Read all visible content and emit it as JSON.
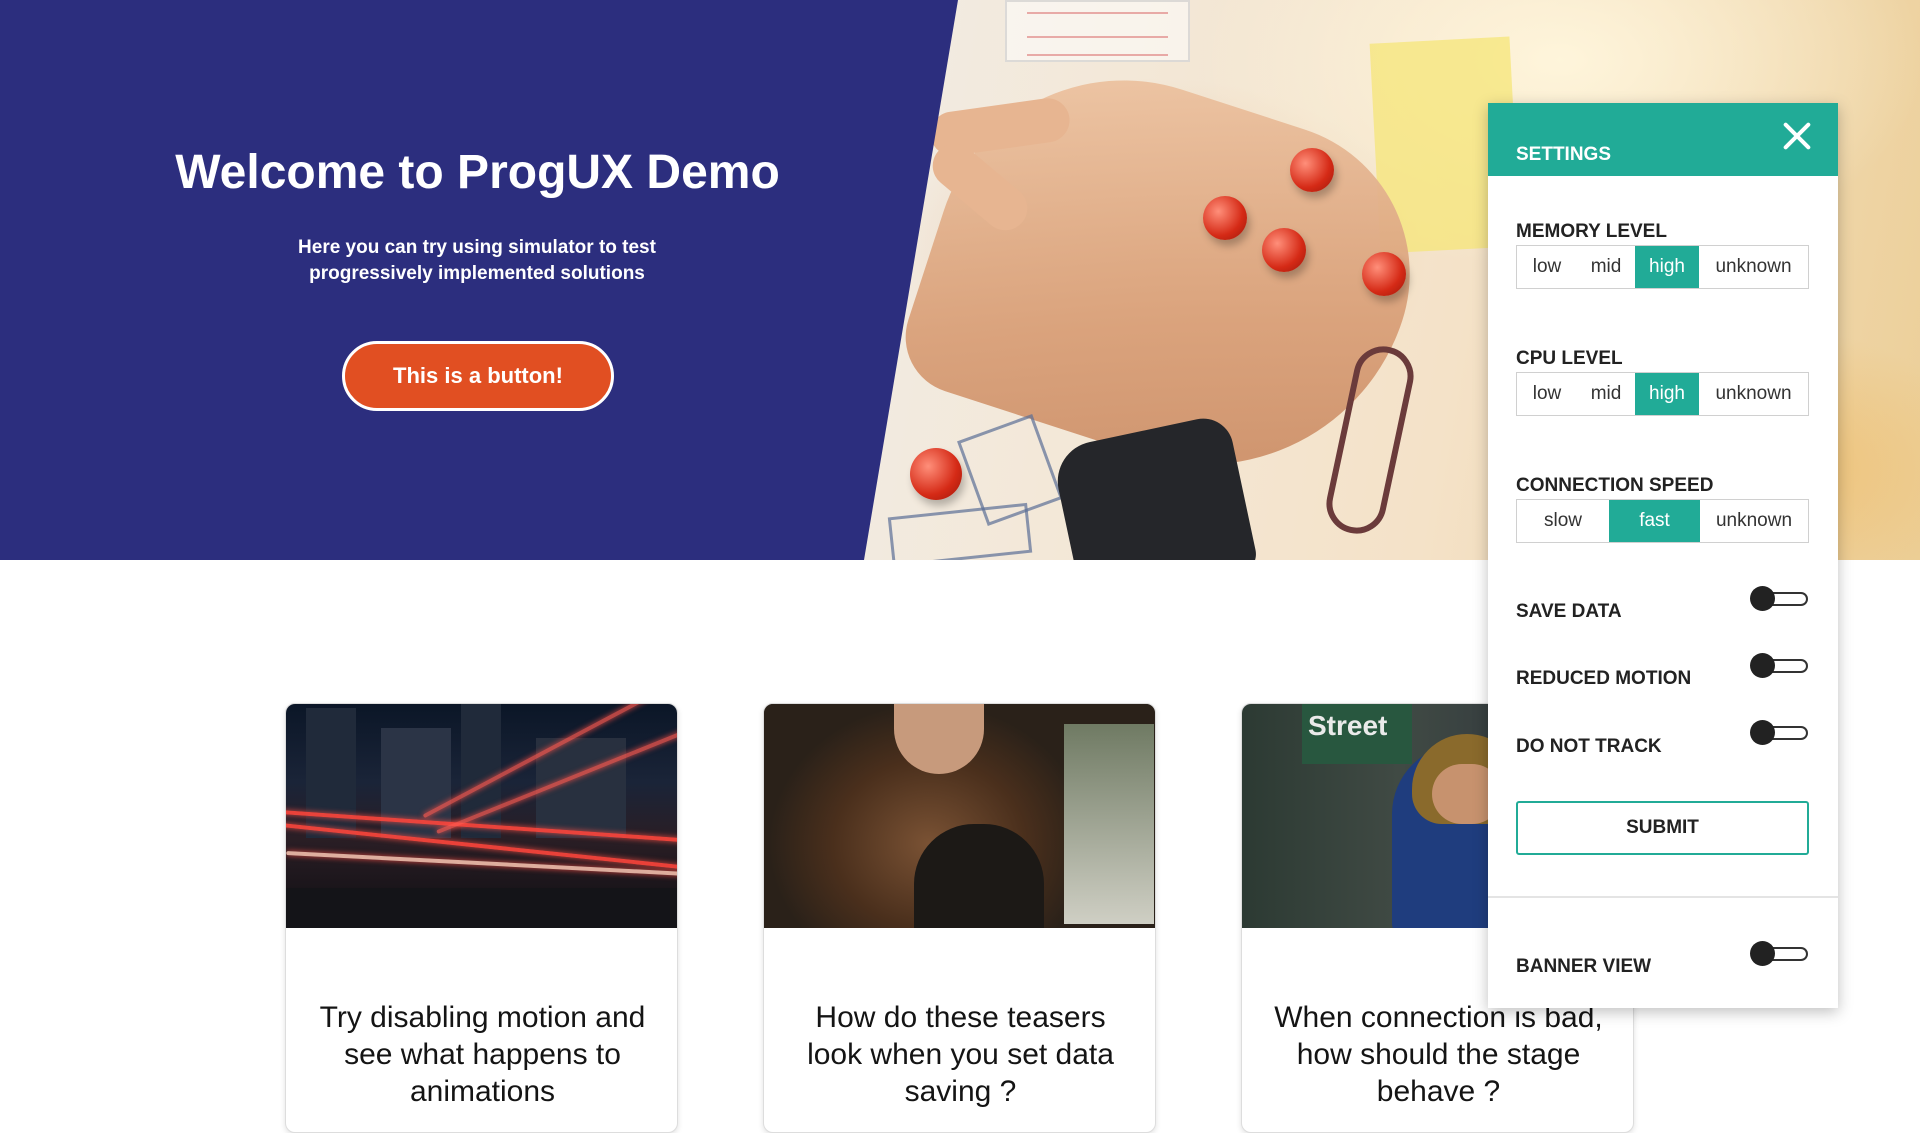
{
  "hero": {
    "title": "Welcome to ProgUX Demo",
    "subtitle": "Here you can try using simulator to test progressively implemented solutions",
    "button_label": "This is a button!"
  },
  "cards": [
    {
      "title": "Try disabling motion and see what happens to animations",
      "image": "city-light-trails-photo"
    },
    {
      "title": "How do these teasers look when you set data saving ?",
      "image": "curly-hair-woman-photo"
    },
    {
      "title": "When connection is bad, how should the stage behave ?",
      "image": "street-hooded-man-photo"
    }
  ],
  "settings": {
    "title": "SETTINGS",
    "close_icon": "close-icon",
    "memory": {
      "label": "MEMORY LEVEL",
      "options": [
        "low",
        "mid",
        "high",
        "unknown"
      ],
      "selected": "high"
    },
    "cpu": {
      "label": "CPU LEVEL",
      "options": [
        "low",
        "mid",
        "high",
        "unknown"
      ],
      "selected": "high"
    },
    "connection": {
      "label": "CONNECTION SPEED",
      "options": [
        "slow",
        "fast",
        "unknown"
      ],
      "selected": "fast"
    },
    "save_data": {
      "label": "SAVE DATA",
      "on": false
    },
    "reduced_motion": {
      "label": "REDUCED MOTION",
      "on": false
    },
    "do_not_track": {
      "label": "DO NOT TRACK",
      "on": false
    },
    "submit_label": "SUBMIT",
    "banner_view": {
      "label": "BANNER VIEW",
      "on": false
    }
  },
  "colors": {
    "hero_bg": "#2c2e7e",
    "accent": "#21ab97",
    "cta": "#e14f22"
  }
}
